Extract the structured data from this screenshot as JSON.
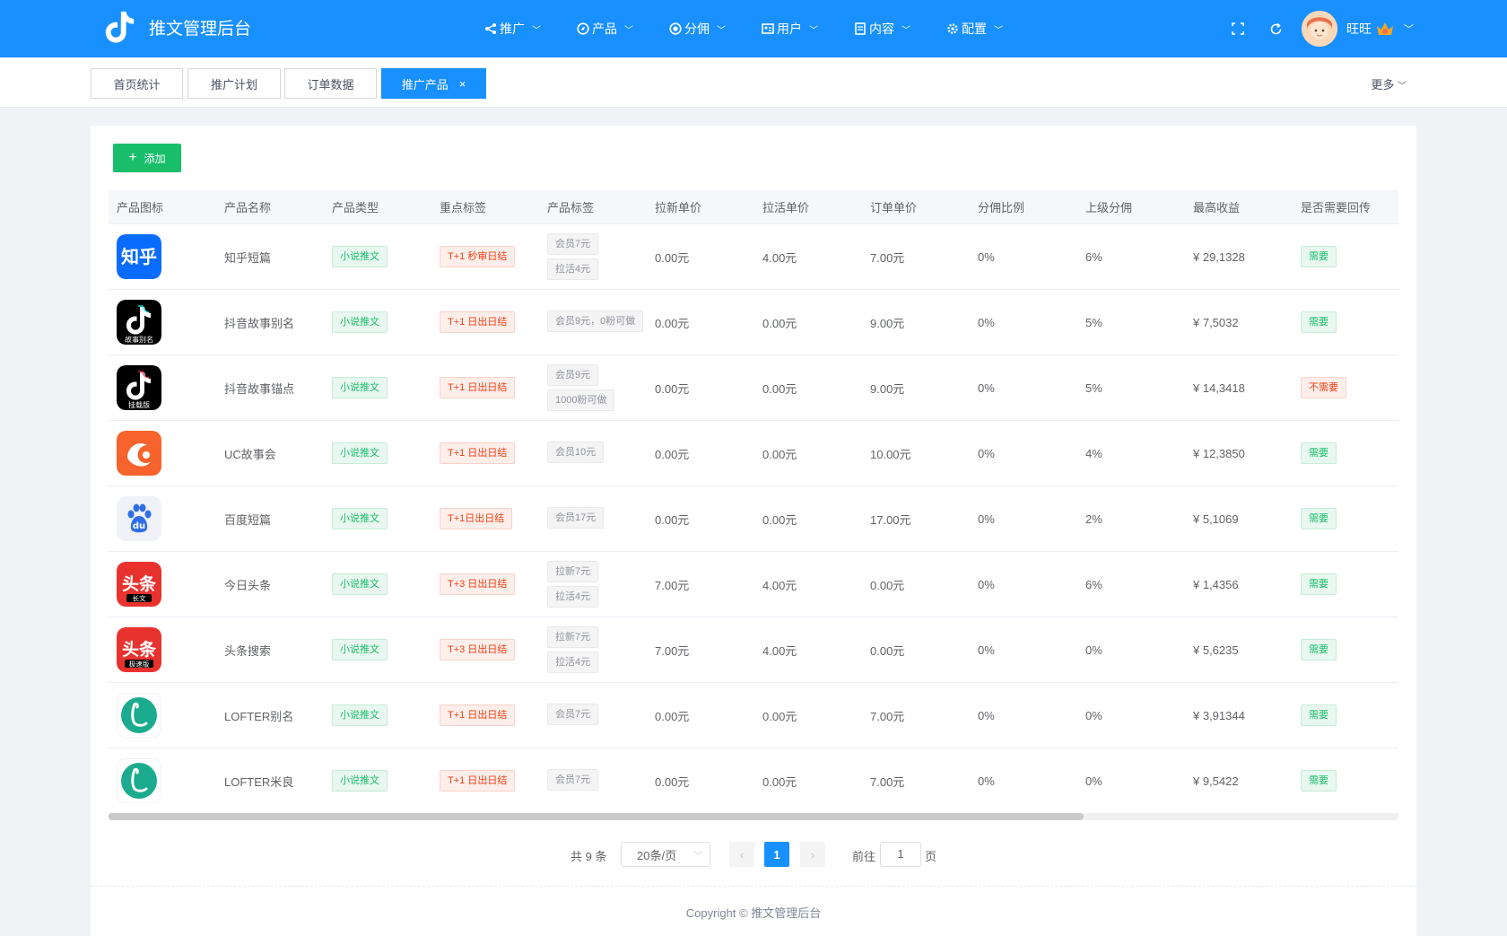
{
  "app": {
    "title": "推文管理后台"
  },
  "nav": [
    {
      "label": "推广",
      "icon": "share-icon"
    },
    {
      "label": "产品",
      "icon": "compass-icon"
    },
    {
      "label": "分佣",
      "icon": "dollar-circle-icon"
    },
    {
      "label": "用户",
      "icon": "user-card-icon"
    },
    {
      "label": "内容",
      "icon": "document-icon"
    },
    {
      "label": "配置",
      "icon": "gear-icon"
    }
  ],
  "user": {
    "name": "旺旺"
  },
  "tabs": [
    {
      "label": "首页统计",
      "active": false
    },
    {
      "label": "推广计划",
      "active": false
    },
    {
      "label": "订单数据",
      "active": false
    },
    {
      "label": "推广产品",
      "active": true,
      "close": "×"
    }
  ],
  "more_label": "更多",
  "toolbar": {
    "add_label": "添加",
    "add_icon": "+"
  },
  "table": {
    "headers": [
      "产品图标",
      "产品名称",
      "产品类型",
      "重点标签",
      "产品标签",
      "拉新单价",
      "拉活单价",
      "订单单价",
      "分佣比例",
      "上级分佣",
      "最高收益",
      "是否需要回传"
    ],
    "rows": [
      {
        "icon": "zhihu-icon",
        "name": "知乎短篇",
        "type": "小说推文",
        "key_tag": "T+1 秒审日结",
        "tags": [
          "会员7元",
          "拉活4元"
        ],
        "new_price": "0.00元",
        "active_price": "4.00元",
        "order_price": "7.00元",
        "commission": "0%",
        "parent_commission": "6%",
        "max_income": "¥ 29,1328",
        "callback": "需要",
        "callback_needed": true
      },
      {
        "icon": "douyin-gushi-bieming-icon",
        "name": "抖音故事别名",
        "type": "小说推文",
        "key_tag": "T+1 日出日结",
        "tags": [
          "会员9元，0粉可做"
        ],
        "new_price": "0.00元",
        "active_price": "0.00元",
        "order_price": "9.00元",
        "commission": "0%",
        "parent_commission": "5%",
        "max_income": "¥ 7,5032",
        "callback": "需要",
        "callback_needed": true
      },
      {
        "icon": "douyin-guazai-icon",
        "name": "抖音故事锚点",
        "type": "小说推文",
        "key_tag": "T+1 日出日结",
        "tags": [
          "会员9元",
          "1000粉可做"
        ],
        "new_price": "0.00元",
        "active_price": "0.00元",
        "order_price": "9.00元",
        "commission": "0%",
        "parent_commission": "5%",
        "max_income": "¥ 14,3418",
        "callback": "不需要",
        "callback_needed": false
      },
      {
        "icon": "uc-icon",
        "name": "UC故事会",
        "type": "小说推文",
        "key_tag": "T+1 日出日结",
        "tags": [
          "会员10元"
        ],
        "new_price": "0.00元",
        "active_price": "0.00元",
        "order_price": "10.00元",
        "commission": "0%",
        "parent_commission": "4%",
        "max_income": "¥ 12,3850",
        "callback": "需要",
        "callback_needed": true
      },
      {
        "icon": "baidu-icon",
        "name": "百度短篇",
        "type": "小说推文",
        "key_tag": "T+1日出日结",
        "tags": [
          "会员17元"
        ],
        "new_price": "0.00元",
        "active_price": "0.00元",
        "order_price": "17.00元",
        "commission": "0%",
        "parent_commission": "2%",
        "max_income": "¥ 5,1069",
        "callback": "需要",
        "callback_needed": true
      },
      {
        "icon": "toutiao-changwen-icon",
        "name": "今日头条",
        "type": "小说推文",
        "key_tag": "T+3 日出日结",
        "tags": [
          "拉新7元",
          "拉活4元"
        ],
        "new_price": "7.00元",
        "active_price": "4.00元",
        "order_price": "0.00元",
        "commission": "0%",
        "parent_commission": "6%",
        "max_income": "¥ 1,4356",
        "callback": "需要",
        "callback_needed": true
      },
      {
        "icon": "toutiao-jisu-icon",
        "name": "头条搜索",
        "type": "小说推文",
        "key_tag": "T+3 日出日结",
        "tags": [
          "拉新7元",
          "拉活4元"
        ],
        "new_price": "7.00元",
        "active_price": "4.00元",
        "order_price": "0.00元",
        "commission": "0%",
        "parent_commission": "0%",
        "max_income": "¥ 5,6235",
        "callback": "需要",
        "callback_needed": true
      },
      {
        "icon": "lofter-icon",
        "name": "LOFTER别名",
        "type": "小说推文",
        "key_tag": "T+1 日出日结",
        "tags": [
          "会员7元"
        ],
        "new_price": "0.00元",
        "active_price": "0.00元",
        "order_price": "7.00元",
        "commission": "0%",
        "parent_commission": "0%",
        "max_income": "¥ 3,91344",
        "callback": "需要",
        "callback_needed": true
      },
      {
        "icon": "lofter-icon",
        "name": "LOFTER米良",
        "type": "小说推文",
        "key_tag": "T+1 日出日结",
        "tags": [
          "会员7元"
        ],
        "new_price": "0.00元",
        "active_price": "0.00元",
        "order_price": "7.00元",
        "commission": "0%",
        "parent_commission": "0%",
        "max_income": "¥ 9,5422",
        "callback": "需要",
        "callback_needed": true
      }
    ]
  },
  "icon_text": {
    "zhihu": "知乎",
    "douyin_1": "故事别名",
    "douyin_2": "挂载版",
    "toutiao": "头条",
    "toutiao_1": "长文",
    "toutiao_2": "极速版",
    "baidu": "du"
  },
  "pagination": {
    "total": "共 9 条",
    "page_size": "20条/页",
    "current_page": "1",
    "goto_label": "前往",
    "goto_value": "1",
    "page_suffix": "页"
  },
  "footer": {
    "copyright": "Copyright © 推文管理后台"
  },
  "colors": {
    "primary": "#1890ff",
    "success": "#19be6b",
    "danger": "#ed4014"
  }
}
